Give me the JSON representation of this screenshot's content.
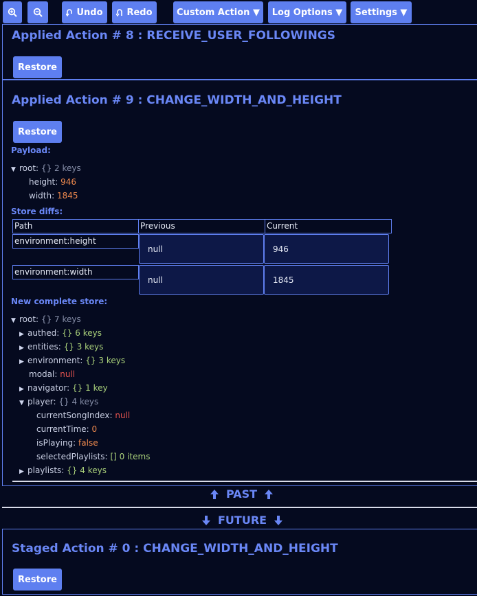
{
  "toolbar": {
    "zoom_in_icon": "zoom-in-icon",
    "zoom_out_icon": "zoom-out-icon",
    "undo_label": "Undo",
    "redo_label": "Redo",
    "custom_action_label": "Custom Action ▼",
    "log_options_label": "Log Options ▼",
    "settings_label": "Settings ▼"
  },
  "action8": {
    "title": "Applied Action # 8 : RECEIVE_USER_FOLLOWINGS",
    "restore_label": "Restore"
  },
  "action9": {
    "title": "Applied Action # 9 : CHANGE_WIDTH_AND_HEIGHT",
    "restore_label": "Restore",
    "payload_label": "Payload:",
    "payload": {
      "root_key": "root:",
      "root_braces": "{}",
      "root_summary": "2 keys",
      "height_key": "height:",
      "height_value": "946",
      "width_key": "width:",
      "width_value": "1845"
    },
    "store_diffs_label": "Store diffs:",
    "diff_table": {
      "headers": {
        "path": "Path",
        "previous": "Previous",
        "current": "Current"
      },
      "rows": [
        {
          "path": "environment:height",
          "previous": "null",
          "current": "946"
        },
        {
          "path": "environment:width",
          "previous": "null",
          "current": "1845"
        }
      ]
    },
    "new_store_label": "New complete store:",
    "store": {
      "root_key": "root:",
      "root_braces": "{}",
      "root_summary": "7 keys",
      "authed_key": "authed:",
      "authed_braces": "{}",
      "authed_summary": "6 keys",
      "entities_key": "entities:",
      "entities_braces": "{}",
      "entities_summary": "3 keys",
      "environment_key": "environment:",
      "environment_braces": "{}",
      "environment_summary": "3 keys",
      "modal_key": "modal:",
      "modal_value": "null",
      "navigator_key": "navigator:",
      "navigator_braces": "{}",
      "navigator_summary": "1 key",
      "player_key": "player:",
      "player_braces": "{}",
      "player_summary": "4 keys",
      "current_song_index_key": "currentSongIndex:",
      "current_song_index_value": "null",
      "current_time_key": "currentTime:",
      "current_time_value": "0",
      "is_playing_key": "isPlaying:",
      "is_playing_value": "false",
      "selected_playlists_key": "selectedPlaylists:",
      "selected_playlists_brackets": "[]",
      "selected_playlists_summary": "0 items",
      "playlists_key": "playlists:",
      "playlists_braces": "{}",
      "playlists_summary": "4 keys"
    }
  },
  "past_label": "PAST",
  "future_label": "FUTURE",
  "staged0": {
    "title": "Staged Action # 0 : CHANGE_WIDTH_AND_HEIGHT",
    "restore_label": "Restore"
  },
  "colors": {
    "background": "#050a1f",
    "accent": "#5e7ff0",
    "title": "#6a87f6",
    "string_value": "#a9d07a",
    "number_value": "#f08a4e",
    "null_value": "#e4534f"
  }
}
